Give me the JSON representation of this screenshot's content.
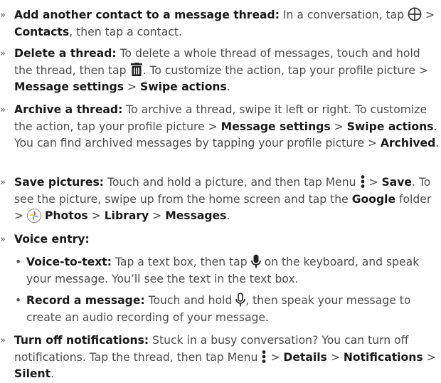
{
  "items": [
    {
      "bold": "Add another contact to a message thread:",
      "t1": " In a conversation, tap ",
      "icon": "add-circle-icon",
      "t2": " > ",
      "b2": "Contacts",
      "t3": ", then tap a contact."
    },
    {
      "bold": "Delete a thread:",
      "t1": " To delete a whole thread of messages, touch and hold the thread, then tap ",
      "icon": "trash-icon",
      "t2": ". To customize the action, tap your profile picture > ",
      "b2": "Message settings",
      "t3": " > ",
      "b3": "Swipe actions",
      "t4": "."
    },
    {
      "bold": "Archive a thread:",
      "t1": " To archive a thread, swipe it left or right. To customize the action, tap your profile picture > ",
      "b2": "Message settings",
      "t2": " > ",
      "b3": "Swipe actions",
      "t3": ". You can find archived messages by tapping your profile picture > ",
      "b4": "Archived",
      "t4": "."
    },
    {
      "bold": "Save pictures:",
      "t1": " Touch and hold a picture, and then tap Menu ",
      "icon": "menu-dots-icon",
      "t2": " > ",
      "b2": "Save",
      "t3": ". To see the picture, swipe up from the home screen and tap the ",
      "b3": "Google",
      "t4": " folder > ",
      "icon2": "google-photos-icon",
      "b4": "Photos",
      "t5": " > ",
      "b5": "Library",
      "t6": " > ",
      "b6": "Messages",
      "t7": "."
    },
    {
      "bold": "Voice entry:"
    },
    {
      "bold": "Turn off notifications:",
      "t1": " Stuck in a busy conversation? You can turn off notifications. Tap the thread, then tap Menu ",
      "icon": "menu-dots-icon",
      "t2": " > ",
      "b2": "Details",
      "t3": " > ",
      "b3": "Notifications",
      "t4": " > ",
      "b4": "Silent",
      "t5": "."
    }
  ],
  "sub_items": [
    {
      "bold": "Voice-to-text:",
      "t1": " Tap a text box, then tap ",
      "icon": "microphone-icon",
      "t2": " on the keyboard, and speak your message. You’ll see the text in the text box."
    },
    {
      "bold": "Record a message:",
      "t1": " Touch and hold ",
      "icon": "microphone-outline-icon",
      "t2": ", then speak your message to create an audio recording of your message."
    }
  ],
  "bullet_marker": "»",
  "sub_marker": "•"
}
